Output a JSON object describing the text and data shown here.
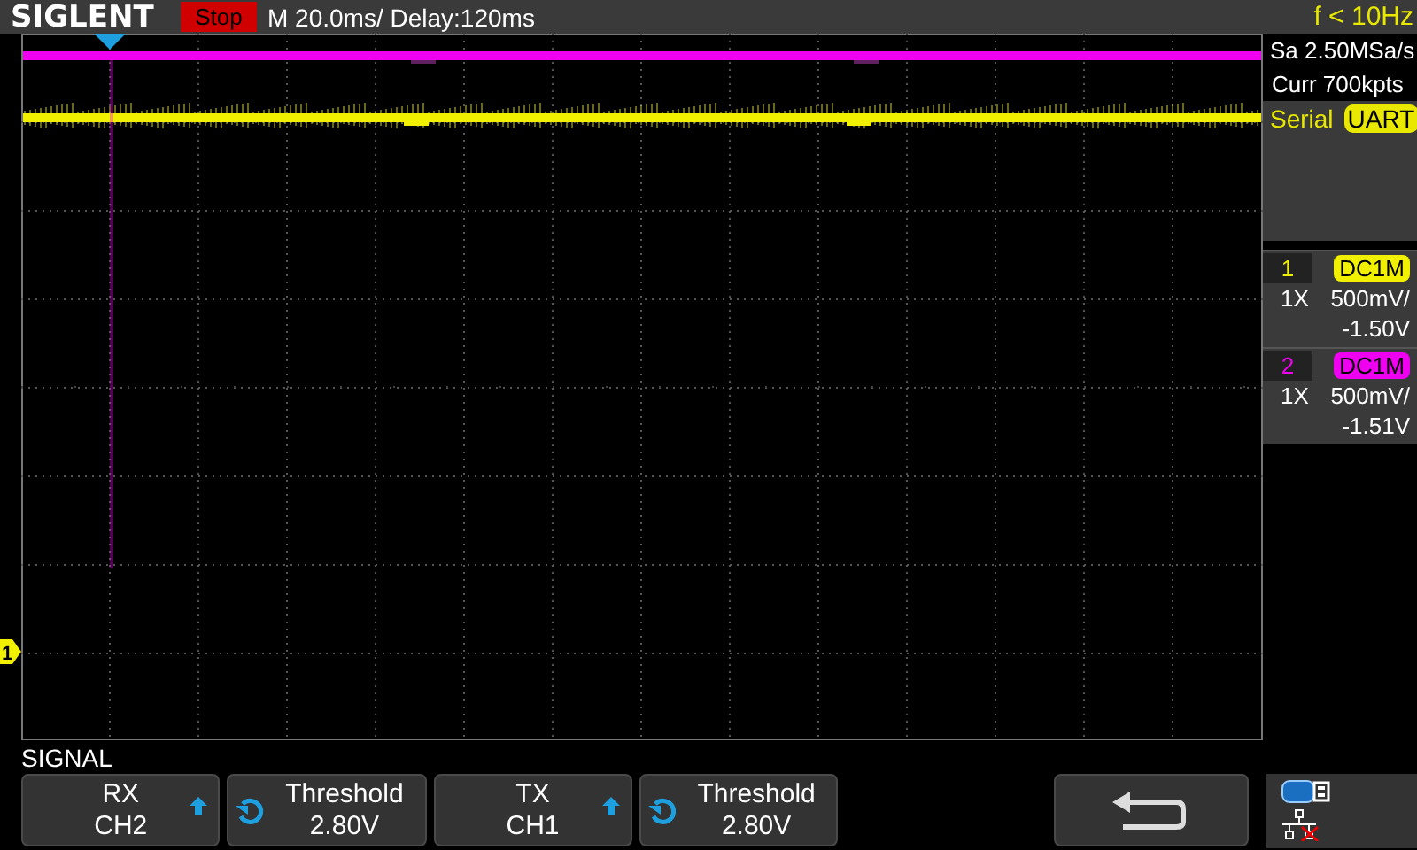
{
  "header": {
    "logo": "SIGLENT",
    "run_state": "Stop",
    "timebase": "M 20.0ms/ Delay:120ms",
    "frequency": "f < 10Hz"
  },
  "acquisition": {
    "sample_rate": "Sa 2.50MSa/s",
    "memory_depth": "Curr 700kpts"
  },
  "decode": {
    "label": "Serial",
    "protocol": "UART"
  },
  "channels": [
    {
      "number": "1",
      "color": "#f0f000",
      "probe": "1X",
      "coupling": "DC1M",
      "scale": "500mV/",
      "offset": "-1.50V"
    },
    {
      "number": "2",
      "color": "#f000f0",
      "probe": "1X",
      "coupling": "DC1M",
      "scale": "500mV/",
      "offset": "-1.51V"
    }
  ],
  "screen": {
    "channel_marker": "1"
  },
  "menu": {
    "title": "SIGNAL",
    "buttons": [
      {
        "kind": "select",
        "lines": [
          "RX",
          "CH2"
        ]
      },
      {
        "kind": "knob",
        "lines": [
          "Threshold",
          "2.80V"
        ]
      },
      {
        "kind": "select",
        "lines": [
          "TX",
          "CH1"
        ]
      },
      {
        "kind": "knob",
        "lines": [
          "Threshold",
          "2.80V"
        ]
      },
      {
        "kind": "back"
      }
    ]
  }
}
